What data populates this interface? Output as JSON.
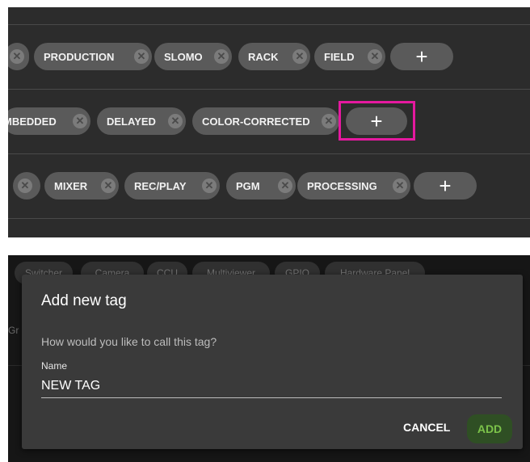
{
  "tag_rows": {
    "row1": {
      "chips": [
        "PRODUCTION",
        "SLOMO",
        "RACK",
        "FIELD"
      ],
      "remove_glyph": "⊗",
      "add_label": "+"
    },
    "row2": {
      "chips": [
        "MBEDDED",
        "DELAYED",
        "COLOR-CORRECTED"
      ],
      "add_label": "+"
    },
    "row3": {
      "chips": [
        "MIXER",
        "REC/PLAY",
        "PGM",
        "PROCESSING"
      ],
      "add_label": "+"
    },
    "highlight_color": "#e5199f"
  },
  "background_tabs": [
    "Switcher",
    "Camera",
    "CCU",
    "Multiviewer",
    "GPIO",
    "Hardware Panel"
  ],
  "background_left_text": "Gr",
  "dialog": {
    "title": "Add new tag",
    "prompt": "How would you like to call this tag?",
    "name_label": "Name",
    "name_value": "NEW TAG",
    "cancel_label": "CANCEL",
    "add_label": "ADD",
    "add_color": "#7cc34a"
  },
  "icons": {
    "chip_remove": "close-circle-icon",
    "add": "plus-icon"
  }
}
